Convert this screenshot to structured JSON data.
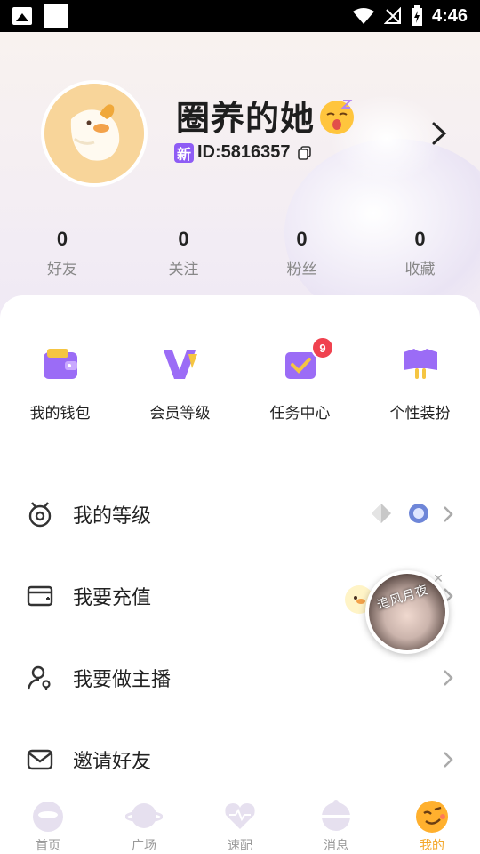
{
  "status_bar": {
    "time": "4:46",
    "icons": [
      "image-icon",
      "blank-square",
      "wifi-icon",
      "signal-muted-icon",
      "battery-charging-icon"
    ]
  },
  "profile": {
    "nickname": "圈养的她",
    "new_badge": "新",
    "id_text": "ID:5816357",
    "stats": [
      {
        "value": "0",
        "label": "好友"
      },
      {
        "value": "0",
        "label": "关注"
      },
      {
        "value": "0",
        "label": "粉丝"
      },
      {
        "value": "0",
        "label": "收藏"
      }
    ]
  },
  "quick_actions": [
    {
      "label": "我的钱包",
      "icon": "wallet-icon"
    },
    {
      "label": "会员等级",
      "icon": "vip-icon"
    },
    {
      "label": "任务中心",
      "icon": "task-icon",
      "badge": "9"
    },
    {
      "label": "个性装扮",
      "icon": "dress-up-icon"
    }
  ],
  "menu": [
    {
      "label": "我的等级",
      "icon": "medal-icon"
    },
    {
      "label": "我要充值",
      "icon": "recharge-icon"
    },
    {
      "label": "我要做主播",
      "icon": "streamer-icon"
    },
    {
      "label": "邀请好友",
      "icon": "mail-icon"
    }
  ],
  "floating_video": {
    "overlay_text": "追风月夜"
  },
  "bottom_nav": [
    {
      "label": "首页",
      "active": false
    },
    {
      "label": "广场",
      "active": false
    },
    {
      "label": "速配",
      "active": false
    },
    {
      "label": "消息",
      "active": false
    },
    {
      "label": "我的",
      "active": true
    }
  ],
  "colors": {
    "accent_purple": "#8e5cf5",
    "active_orange": "#f3a72a",
    "badge_red": "#f0424f"
  }
}
